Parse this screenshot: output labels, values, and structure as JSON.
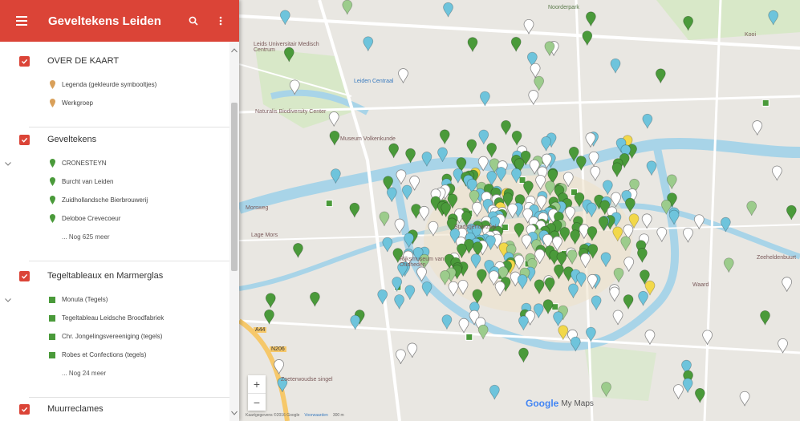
{
  "header": {
    "title": "Geveltekens Leiden"
  },
  "sections": [
    {
      "title": "OVER DE KAART",
      "items": [
        {
          "label": "Legenda (gekleurde symbooltjes)",
          "icon": "pin-orange"
        },
        {
          "label": "Werkgroep",
          "icon": "pin-orange"
        }
      ]
    },
    {
      "title": "Geveltekens",
      "items": [
        {
          "label": "CRONESTEYN",
          "icon": "pin-green"
        },
        {
          "label": "Burcht van Leiden",
          "icon": "pin-green"
        },
        {
          "label": "Zuidhollandsche Bierbrouwerij",
          "icon": "pin-green"
        },
        {
          "label": "Deloboe Crevecoeur",
          "icon": "pin-green"
        }
      ],
      "more": "... Nog 625 meer"
    },
    {
      "title": "Tegeltableaux en Marmerglas",
      "items": [
        {
          "label": "Monuta (Tegels)",
          "icon": "square-green"
        },
        {
          "label": "Tegeltableau Leidsche Broodfabriek",
          "icon": "square-green"
        },
        {
          "label": "Chr. Jongelingsvereeniging (tegels)",
          "icon": "square-green"
        },
        {
          "label": "Robes et Confections (tegels)",
          "icon": "square-green"
        }
      ],
      "more": "... Nog 24 meer"
    },
    {
      "title": "Muurreclames"
    }
  ],
  "map": {
    "labels": [
      "Noorderpark",
      "Leids Universitair Medisch Centrum",
      "Leiden Centraal",
      "Naturalis Biodiversity Center",
      "Museum Volkenkunde",
      "Rijksmuseum van Oudheden",
      "Zeeheldenbuurt",
      "Waard",
      "Kooi",
      "Morsweg",
      "Lage Mors",
      "Stadsgehoorzaal",
      "A44",
      "N206",
      "Zoeterwoudse singel"
    ],
    "attribution": [
      "Kaartgegevens ©2016 Google",
      "Voorwaarden",
      "300 m"
    ],
    "branding": {
      "google": "Google",
      "product": "My Maps"
    }
  },
  "colors": {
    "accent": "#db4437",
    "pin_green": "#4a9a3a",
    "pin_light_green": "#9ccc8c",
    "pin_blue": "#6ec4dc",
    "pin_white": "#ffffff",
    "pin_yellow": "#f2d84a",
    "water": "#a8d4e8",
    "road": "#ffffff"
  }
}
